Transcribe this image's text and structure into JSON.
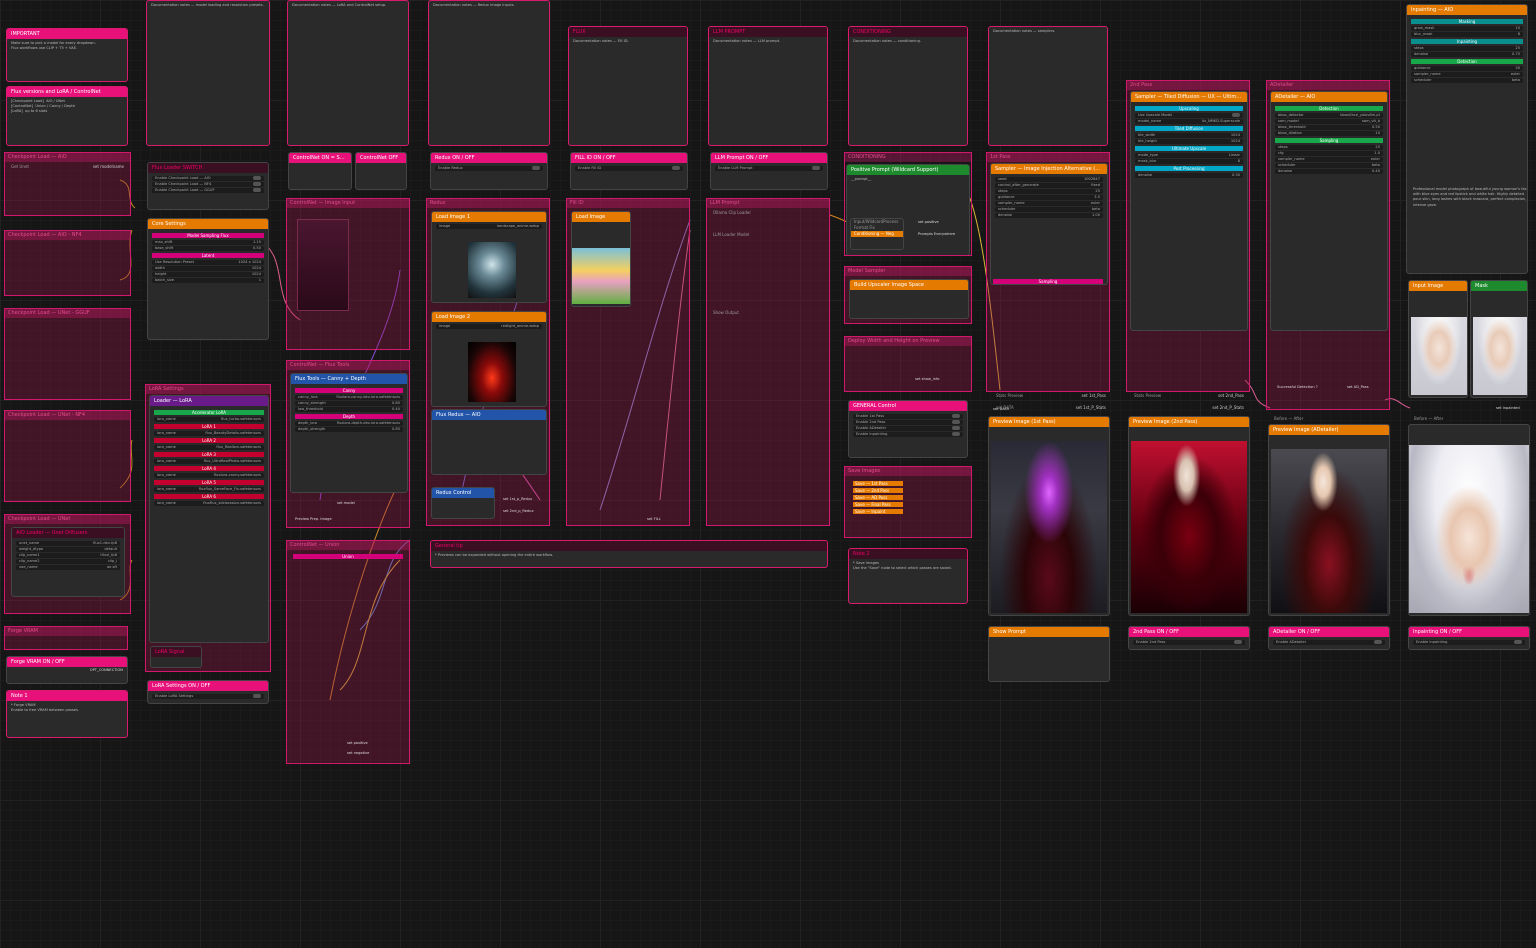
{
  "col1": {
    "important_title": "IMPORTANT",
    "flux_versions_title": "Flux versions and LoRA / ControlNet",
    "checkpoint_aio": "Checkpoint Load — AIO",
    "checkpoint_nf4": "Checkpoint Load — AIO - NF4",
    "checkpoint_gguf": "Checkpoint Load — UNet - GGUF",
    "checkpoint_unet_nf4": "Checkpoint Load — UNet - NF4",
    "unet_loader": "Checkpoint Load — UNet",
    "unet_loader_inner": "AIO Loader — Unet Diffusers",
    "forge_vram": "Forge VRAM",
    "forge_onoff": "Forge VRAM ON / OFF",
    "note": "Note 1",
    "opt_connection": "OPT_CONNECTION",
    "get_unet": "Get Unet",
    "get_clip": "Get CLIP",
    "get_vae": "Get VAE",
    "set_modelname": "set modelname"
  },
  "col2": {
    "flux_loader_switch": "Flux Loader SWITCH",
    "core_settings": "Core Settings",
    "ctx_model": "Model Sampling Flux",
    "latent": "Latent",
    "resolution_preset": "Use Resolution Preset",
    "lora_settings": "LoRA Settings",
    "lora_loader": "Loader — LoRA",
    "accelerator": "Accelerator LoRA",
    "lora_1": "LoRA 1",
    "lora_2": "LoRA 2",
    "lora_3": "LoRA 3",
    "lora_4": "LoRA 4",
    "lora_5": "LoRA 5",
    "lora_6": "LoRA 6",
    "lora_signal": "LoRA Signal",
    "lora_onoff": "LoRA Settings ON / OFF",
    "enable_lora": "Enable LoRA Settings"
  },
  "col3": {
    "controlnet_switch": "ControlNet ON = SWITCH",
    "controlnet_off": "ControlNet OFF",
    "controlnet_image_input": "ControlNet — Image Input",
    "controlnet_load": "ControlNet",
    "controlnet_flux_tools": "ControlNet — Flux Tools",
    "flux_tools_canny": "Flux Tools — Canny + Depth",
    "canny_bar": "Canny",
    "depth_bar": "Depth",
    "preview_image": "Preview Image",
    "controlnet_union": "ControlNet — Union",
    "union_bar": "Union",
    "controlnet_apply": "ControlNet Apply",
    "set_positive": "set positive",
    "set_negative": "set negative",
    "set_model": "set model",
    "preview_prep_image": "Preview Prep. Image"
  },
  "col4": {
    "redux_onoff": "Redux ON / OFF",
    "enable_redux": "Enable Redux",
    "redux": "Redux",
    "load_image_1": "Load Image 1",
    "load_image_2": "Load Image 2",
    "image_file_1": "landscape_anime.webp",
    "image_file_2": "redlight_anime.webp",
    "flux_redux": "Flux Redux — AIO",
    "redux_control": "Redux Control",
    "general_group": "General tip",
    "set_1st_redux": "set 1st_p_Redux",
    "set_2nd_redux": "set 2nd_p_Redux"
  },
  "col5": {
    "fill_title": "FLUX",
    "fill_onoff": "FILL ID ON / OFF",
    "enable_fill": "Enable Fill ID",
    "fill_id": "Fill ID",
    "load_image": "Load Image",
    "fill_image_file": "pikachu_hood.png",
    "set_fill": "set FILL"
  },
  "col6": {
    "llm_title": "LLM PROMPT",
    "llm_onoff": "LLM Prompt ON / OFF",
    "enable_llm": "Enable LLM Prompt",
    "llm_prompt": "LLM Prompt",
    "ollama": "Ollama Clip Loader",
    "llm_loader": "LLM Loader Model",
    "show_output": "Show Output",
    "llm_prompt_output": "LLM Prompt Output"
  },
  "col7": {
    "conditioning": "CONDITIONING",
    "positive_prompt": "Positive Prompt (Wildcard Support)",
    "conditioning_box": "Conditioning",
    "input_wildcard": "Input/WildcardProcess",
    "format_fix": "Format Fix",
    "conditioning_neg": "Conditioning — Neg",
    "prompts_everywhere": "Prompts Everywhere",
    "model_sampler": "Model Sampler",
    "build_upscaler": "Build Upscaler Image Space",
    "display_width": "Deploy Width and Height on Preview",
    "general_control": "GENERAL Control",
    "save_images": "Save Images",
    "note": "Note 2",
    "set_positive": "set positive",
    "set_auto": "set auto",
    "set_show_info": "set show_info",
    "save_options": [
      "Save — 1st Pass",
      "Save — 2nd Pass",
      "Save — AD Pass",
      "Save — Final Pass",
      "Save — Inpaint"
    ]
  },
  "col8": {
    "first_pass": "1st Pass",
    "sampler": "Sampler — Image Injection Alternative (Only)",
    "set_data": "set DATA",
    "stats_preview": "Stats Preview",
    "set_1st_pass": "set 1st_Pass",
    "set_1st_stats": "set 1st_P_Stats",
    "preview_image": "Preview Image (1st Pass)",
    "show_prompt": "Show Prompt"
  },
  "col9": {
    "second_pass": "2nd Pass",
    "tiled_diffusion": "Sampler — Tiled Diffusion — UX — Ultimate Upscale",
    "use_upscale": "Use Upscale Model",
    "upscaling": "Upscaling",
    "tiled_diffusion_bar": "Tiled Diffusion",
    "ultimate_upscale": "Ultimate Upscale",
    "post_processing": "Post Processing",
    "second_pass_onoff": "2nd Pass ON / OFF",
    "enable_2nd": "Enable 2nd Pass",
    "preview_2nd": "Preview Image (2nd Pass)",
    "set_2nd_pass": "set 2nd_Pass",
    "set_2nd_stats": "set 2nd_P_Stats",
    "first_pass_2nd": "1st Pass — 2nd Pass"
  },
  "col10": {
    "adetailer": "ADetailer",
    "adetailer_node": "ADetailer — AIO",
    "detection": "Detection",
    "sampling": "Sampling",
    "adetailer_onoff": "ADetailer ON / OFF",
    "enable_adetailer": "Enable ADetailer",
    "successful_detection": "Successful Detection ?",
    "before_after": "Before — After",
    "preview_ad": "Preview Image (ADetailer)",
    "set_ad_pass": "set AD_Pass",
    "model_name": "bbox/face_yolov8m.pt"
  },
  "col11": {
    "inpainting": "Inpainting — AIO",
    "inpainting_onoff": "Inpainting ON / OFF",
    "enable_inpainting": "Enable Inpainting",
    "input_image": "Input Image",
    "mask": "Mask",
    "before_after": "Before — After",
    "set_inpainted": "set Inpainted",
    "masking": "Masking",
    "inpainting_bar": "Inpainting",
    "prompt_text": "Professional model photograph of beautiful young woman's face with blue eyes and red lipstick and white hair. Highly detailed pour skin, long lashes with black mascara, perfect complexion, intense gaze."
  },
  "colors": {
    "accent": "#e8117a",
    "group_border": "#d0196c",
    "orange": "#e57a00",
    "green": "#1e8a2e",
    "teal": "#0a8f8f",
    "background": "#161616"
  }
}
